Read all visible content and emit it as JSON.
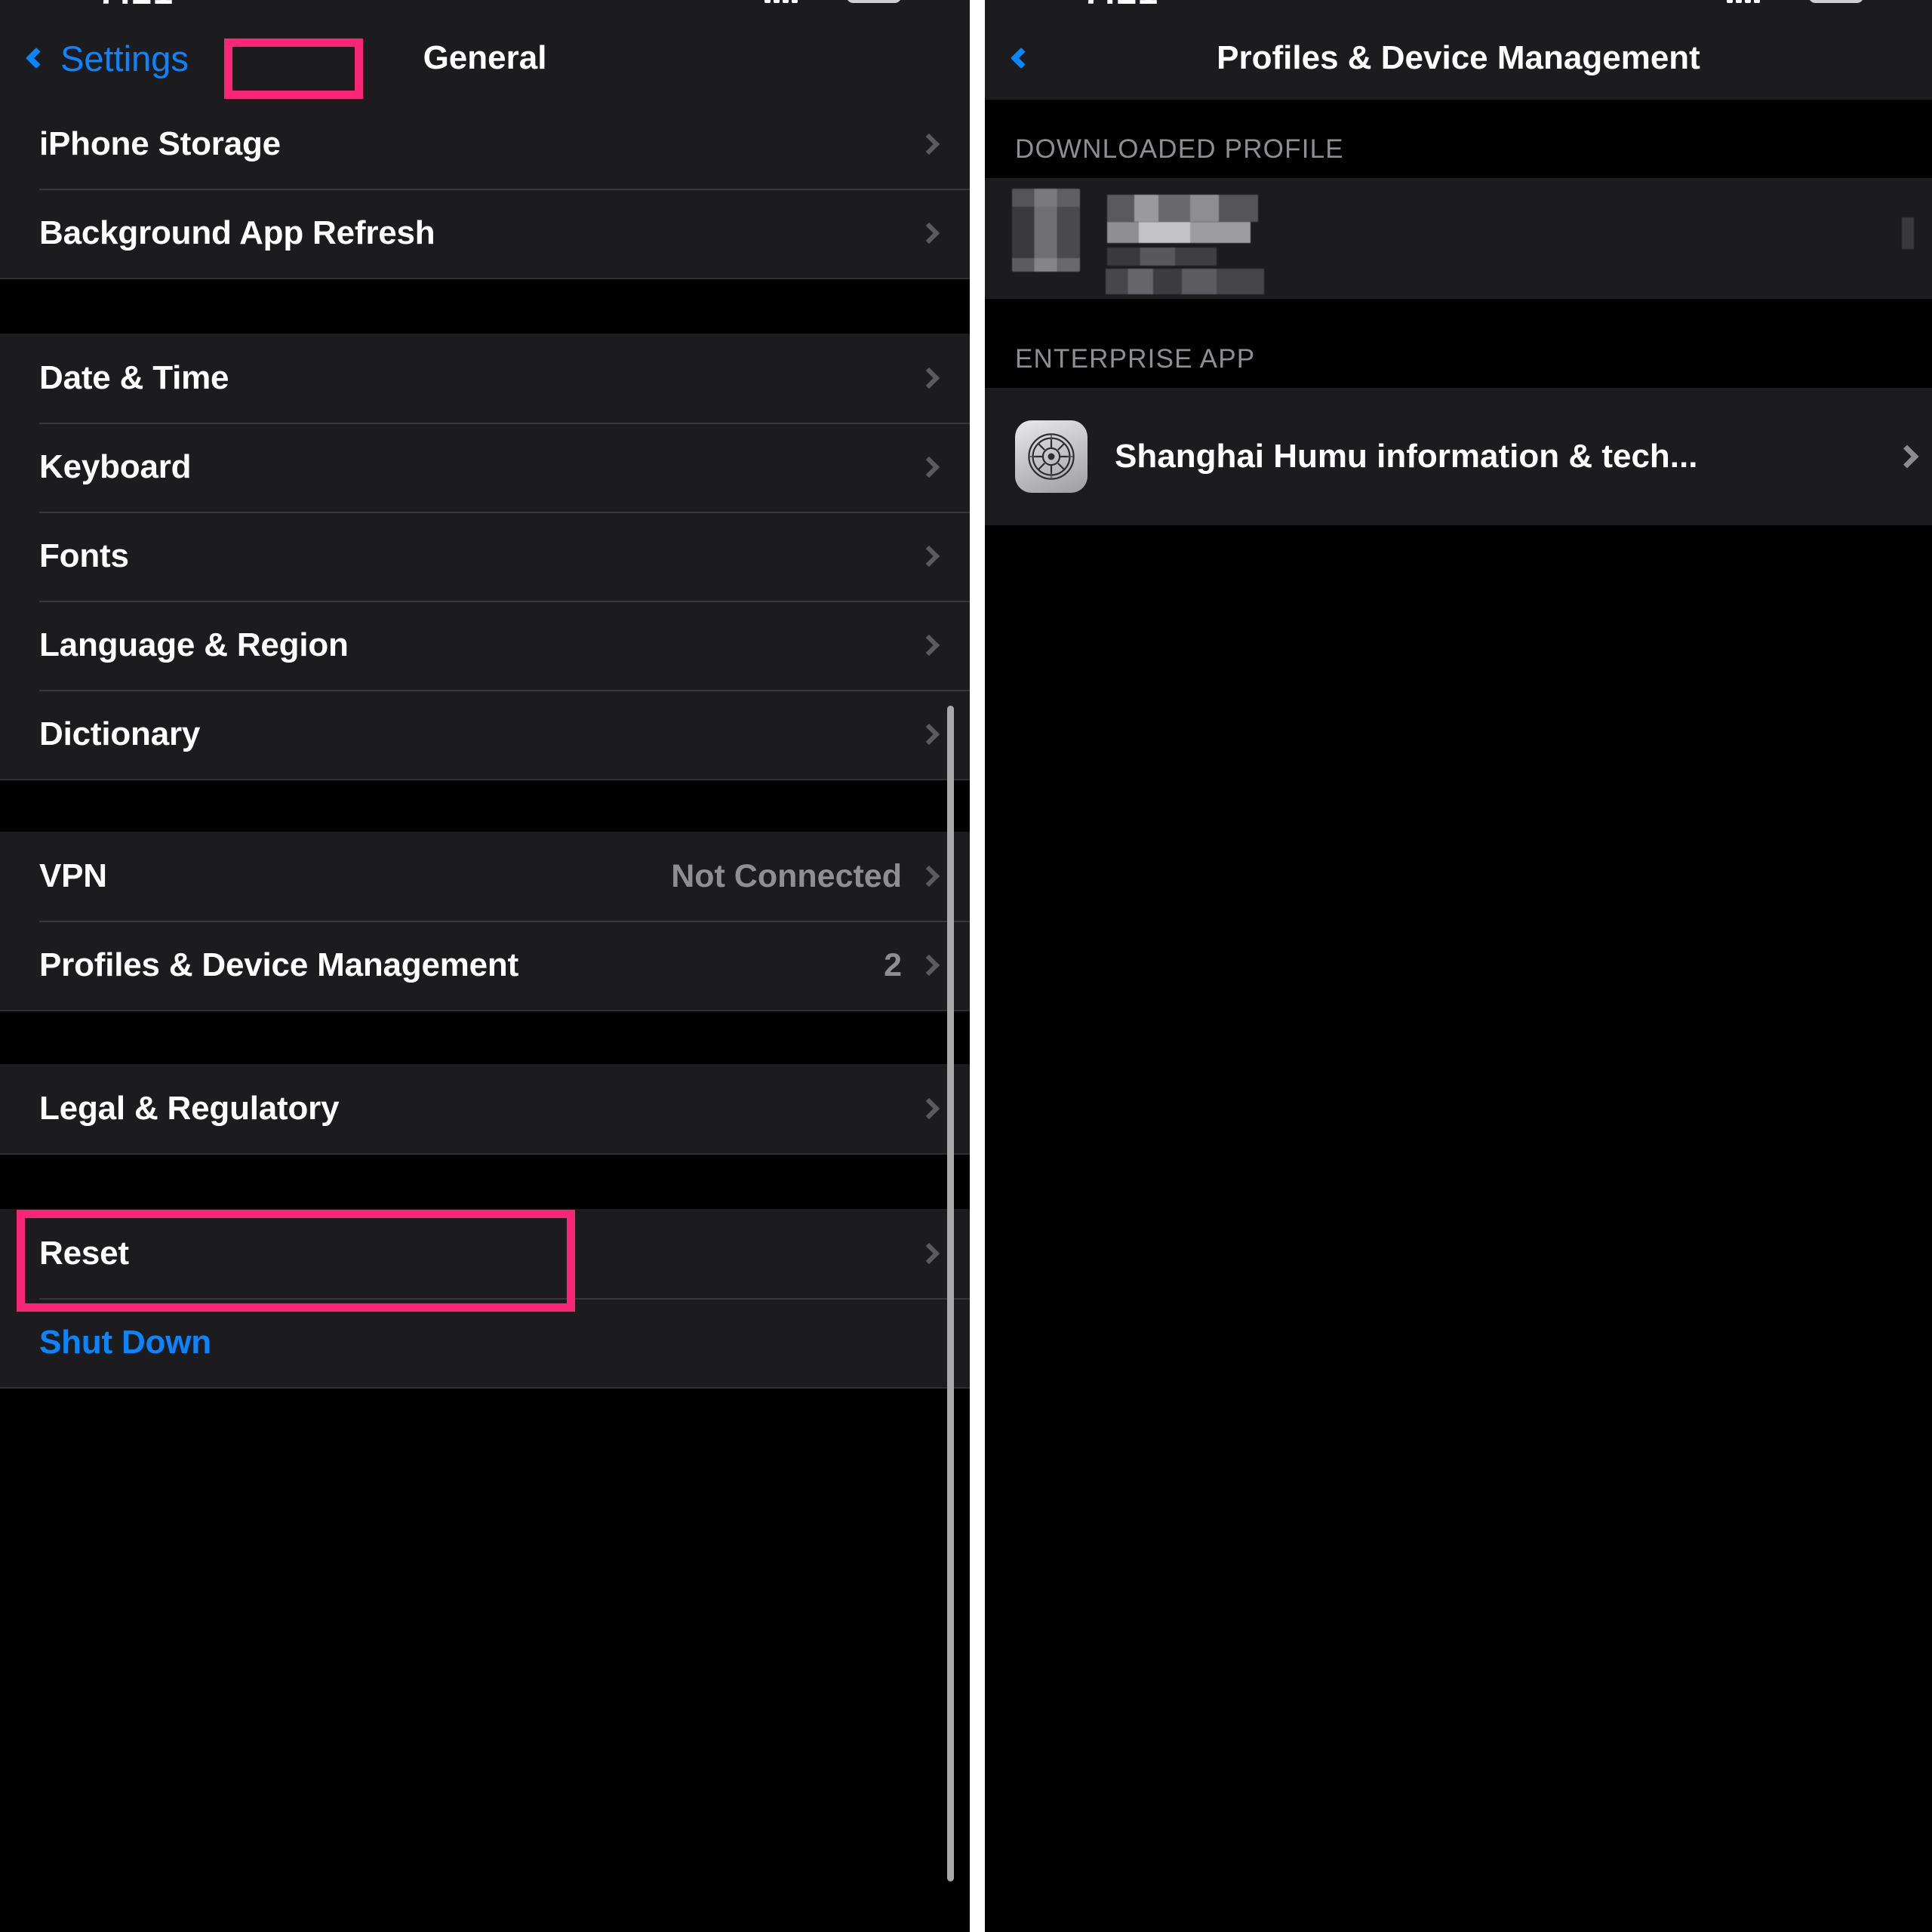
{
  "left_panel": {
    "nav": {
      "back_label": "Settings",
      "back_icon": "chevron-left-icon",
      "title": "General"
    },
    "sections": [
      {
        "rows": [
          {
            "label": "iPhone Storage",
            "value": "",
            "accessory": "chevron-right-icon",
            "style": "normal"
          },
          {
            "label": "Background App Refresh",
            "value": "",
            "accessory": "chevron-right-icon",
            "style": "normal"
          }
        ]
      },
      {
        "rows": [
          {
            "label": "Date & Time",
            "value": "",
            "accessory": "chevron-right-icon",
            "style": "normal"
          },
          {
            "label": "Keyboard",
            "value": "",
            "accessory": "chevron-right-icon",
            "style": "normal"
          },
          {
            "label": "Fonts",
            "value": "",
            "accessory": "chevron-right-icon",
            "style": "normal"
          },
          {
            "label": "Language & Region",
            "value": "",
            "accessory": "chevron-right-icon",
            "style": "normal"
          },
          {
            "label": "Dictionary",
            "value": "",
            "accessory": "chevron-right-icon",
            "style": "normal"
          }
        ]
      },
      {
        "rows": [
          {
            "label": "VPN",
            "value": "Not Connected",
            "accessory": "chevron-right-icon",
            "style": "normal"
          },
          {
            "label": "Profiles & Device Management",
            "value": "2",
            "accessory": "chevron-right-icon",
            "style": "normal"
          }
        ]
      },
      {
        "rows": [
          {
            "label": "Legal & Regulatory",
            "value": "",
            "accessory": "chevron-right-icon",
            "style": "normal"
          }
        ]
      },
      {
        "rows": [
          {
            "label": "Reset",
            "value": "",
            "accessory": "chevron-right-icon",
            "style": "normal"
          },
          {
            "label": "Shut Down",
            "value": "",
            "accessory": "none",
            "style": "link"
          }
        ]
      }
    ]
  },
  "right_panel": {
    "nav": {
      "back_icon": "chevron-left-icon",
      "title": "Profiles & Device Management"
    },
    "sections": [
      {
        "header": "DOWNLOADED PROFILE",
        "redacted_row": {
          "redacted": true,
          "accessory": "chevron-right-icon"
        }
      },
      {
        "header": "ENTERPRISE APP",
        "app_row": {
          "icon": "gear-app-icon",
          "label": "Shanghai Humu information & tech...",
          "accessory": "chevron-right-icon"
        }
      }
    ]
  },
  "annotations": {
    "highlight_color": "#fb2576",
    "boxes": [
      {
        "name": "general-title-highlight"
      },
      {
        "name": "profiles-row-highlight"
      }
    ]
  },
  "theme": {
    "background": "#000000",
    "row_background": "#1c1c1e",
    "separator": "#38383a",
    "primary_text": "#ffffff",
    "secondary_text": "#8e8e93",
    "accent_blue": "#0a84ff"
  }
}
